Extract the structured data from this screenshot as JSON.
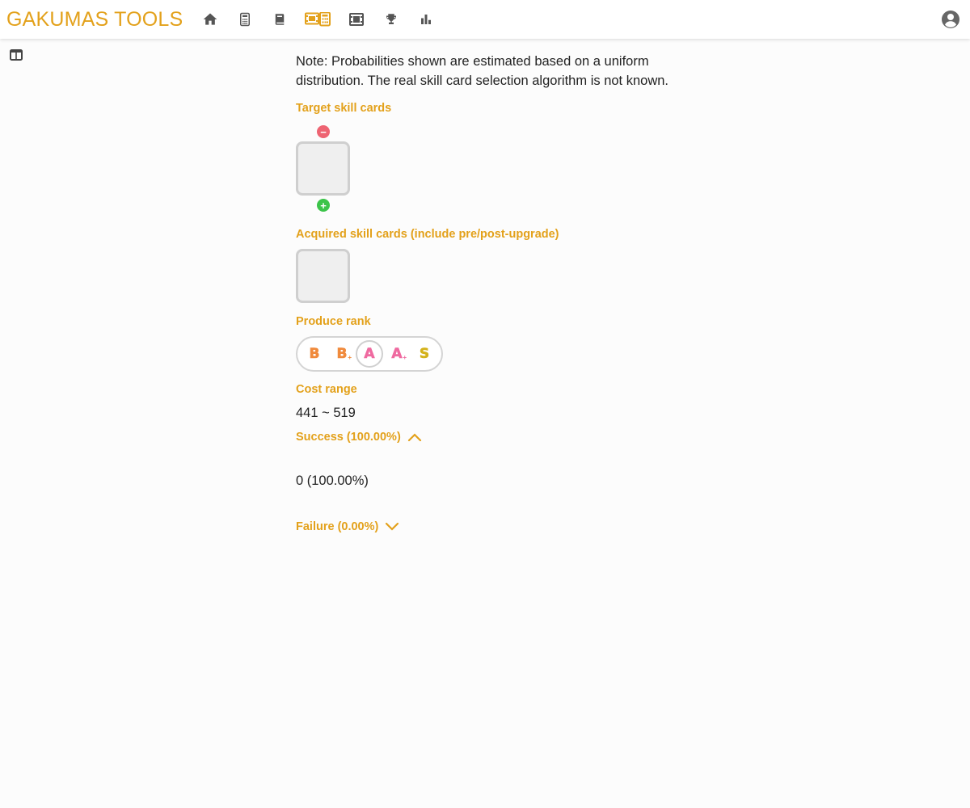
{
  "app": {
    "title": "GAKUMAS TOOLS",
    "accent_color": "#e3a11b"
  },
  "nav": {
    "items": [
      {
        "icon": "home-icon",
        "active": false
      },
      {
        "icon": "calculator-icon",
        "active": false
      },
      {
        "icon": "book-icon",
        "active": false
      },
      {
        "icon": "film-calculator-icon",
        "active": true
      },
      {
        "icon": "film-icon",
        "active": false
      },
      {
        "icon": "trophy-icon",
        "active": false
      },
      {
        "icon": "bar-chart-icon",
        "active": false
      }
    ],
    "account_icon": "account-circle-icon"
  },
  "sidebar": {
    "toggle_icon": "panel-toggle-icon"
  },
  "main": {
    "note": "Note: Probabilities shown are estimated based on a uniform distribution. The real skill card selection algorithm is not known.",
    "target_label": "Target skill cards",
    "acquired_label": "Acquired skill cards (include pre/post-upgrade)",
    "rank_label": "Produce rank",
    "ranks": [
      {
        "letter": "B",
        "plus": false,
        "selected": false
      },
      {
        "letter": "B",
        "plus": true,
        "selected": false
      },
      {
        "letter": "A",
        "plus": false,
        "selected": true
      },
      {
        "letter": "A",
        "plus": true,
        "selected": false
      },
      {
        "letter": "S",
        "plus": false,
        "selected": false
      }
    ],
    "cost_label": "Cost range",
    "cost_value": "441 ~ 519",
    "success_label": "Success (100.00%)",
    "success_expanded": true,
    "success_value": "0 (100.00%)",
    "failure_label": "Failure (0.00%)",
    "failure_expanded": false
  }
}
